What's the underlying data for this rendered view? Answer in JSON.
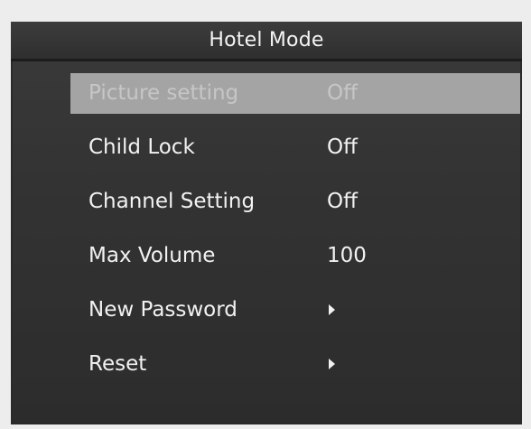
{
  "menu": {
    "title": "Hotel Mode",
    "items": [
      {
        "label": "Picture setting",
        "value": "Off",
        "type": "value",
        "selected": true
      },
      {
        "label": "Child Lock",
        "value": "Off",
        "type": "value",
        "selected": false
      },
      {
        "label": "Channel Setting",
        "value": "Off",
        "type": "value",
        "selected": false
      },
      {
        "label": "Max Volume",
        "value": "100",
        "type": "value",
        "selected": false
      },
      {
        "label": "New Password",
        "value": "",
        "type": "submenu",
        "icon": "triangle-right-icon",
        "selected": false
      },
      {
        "label": "Reset",
        "value": "",
        "type": "submenu",
        "icon": "triangle-right-icon",
        "selected": false
      }
    ]
  },
  "colors": {
    "background": "#333333",
    "selected_highlight": "#a4a4a4",
    "text": "#f2f2f2"
  }
}
